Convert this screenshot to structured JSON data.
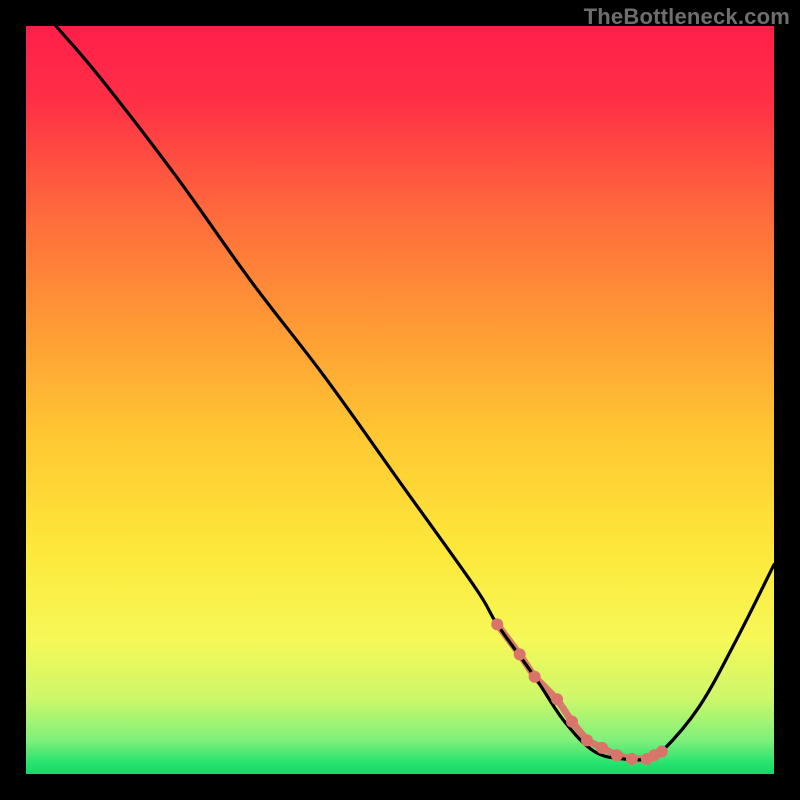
{
  "watermark": "TheBottleneck.com",
  "gradient_stops": [
    {
      "offset": 0.0,
      "color": "#ff1f4a"
    },
    {
      "offset": 0.1,
      "color": "#ff2f46"
    },
    {
      "offset": 0.25,
      "color": "#ff6a3c"
    },
    {
      "offset": 0.4,
      "color": "#ff9a35"
    },
    {
      "offset": 0.55,
      "color": "#ffc832"
    },
    {
      "offset": 0.7,
      "color": "#fde83a"
    },
    {
      "offset": 0.82,
      "color": "#f6f857"
    },
    {
      "offset": 0.9,
      "color": "#ccf76a"
    },
    {
      "offset": 0.955,
      "color": "#7ef07a"
    },
    {
      "offset": 0.985,
      "color": "#27e36f"
    },
    {
      "offset": 1.0,
      "color": "#17d768"
    }
  ],
  "chart_data": {
    "type": "line",
    "title": "",
    "xlabel": "",
    "ylabel": "",
    "xlim": [
      0,
      100
    ],
    "ylim": [
      0,
      100
    ],
    "grid": false,
    "series": [
      {
        "name": "bottleneck-curve",
        "color": "#000000",
        "x": [
          4,
          10,
          20,
          30,
          40,
          50,
          60,
          63,
          68,
          72,
          76,
          80,
          83,
          85,
          90,
          95,
          100
        ],
        "values": [
          100,
          93,
          80,
          66,
          53,
          39,
          25,
          20,
          13,
          7,
          3,
          2,
          2,
          3,
          9,
          18,
          28
        ]
      }
    ],
    "markers": {
      "name": "valley-points",
      "color": "#d9746b",
      "radius_px": 6,
      "connect": true,
      "x": [
        63,
        66,
        68,
        71,
        73,
        75,
        77,
        79,
        81,
        83,
        84,
        85
      ],
      "values": [
        20,
        16,
        13,
        10,
        7,
        4.5,
        3.5,
        2.5,
        2,
        2,
        2.5,
        3
      ]
    }
  }
}
